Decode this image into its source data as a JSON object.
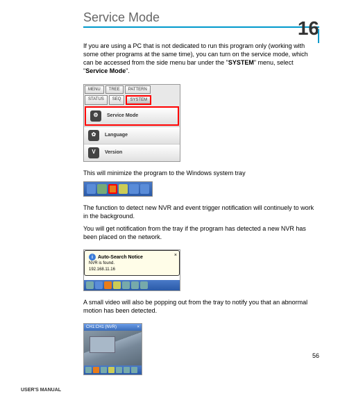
{
  "title": "Service Mode",
  "chapter_number": "16",
  "para1_a": "If you are using a PC that is not dedicated to run this program only (working with some other programs at the same time), you can turn on the service mode, which can be accessed from the side menu bar under the \"",
  "para1_sys": "SYSTEM",
  "para1_b": "\" menu, select \"",
  "para1_sm": "Service Mode",
  "para1_c": "\".",
  "menu_shot": {
    "tabs_row1": [
      "MENU",
      "TREE",
      "PATTERN"
    ],
    "tabs_row2": [
      "STATUS",
      "SEQ",
      "SYSTEM"
    ],
    "items": [
      {
        "icon": "⚙",
        "label": "Service Mode",
        "highlighted": true
      },
      {
        "icon": "✿",
        "label": "Language",
        "highlighted": false
      },
      {
        "icon": "V",
        "label": "Version",
        "highlighted": false
      }
    ]
  },
  "para2": "This will minimize the program to the Windows system tray",
  "para3": "The function to detect new NVR and event trigger notification will continuely to work in the background.",
  "para4": "You will get notification from the tray if the program has detected a new NVR has been placed on the network.",
  "tooltip": {
    "title": "Auto-Search Notice",
    "line1": "NVR is found.",
    "line2": "192.168.11.16"
  },
  "para5": "A small video will also be popping out from the tray to notify you that an abnormal motion has been detected.",
  "video_title": "CH1:CH1 (NVR)",
  "page_number": "56",
  "footer": "USER'S MANUAL"
}
